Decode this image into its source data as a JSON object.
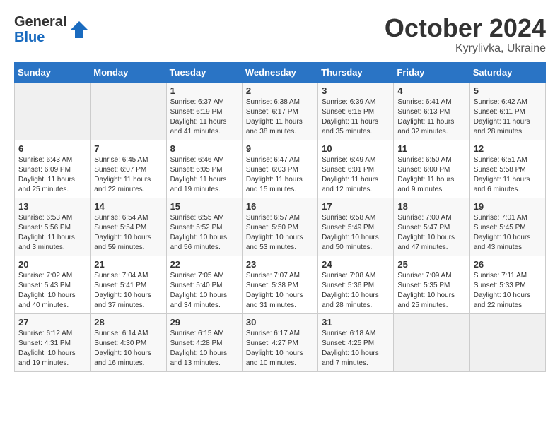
{
  "header": {
    "logo_general": "General",
    "logo_blue": "Blue",
    "month_title": "October 2024",
    "location": "Kyrylivka, Ukraine"
  },
  "days_of_week": [
    "Sunday",
    "Monday",
    "Tuesday",
    "Wednesday",
    "Thursday",
    "Friday",
    "Saturday"
  ],
  "weeks": [
    [
      {
        "day": "",
        "content": ""
      },
      {
        "day": "",
        "content": ""
      },
      {
        "day": "1",
        "content": "Sunrise: 6:37 AM\nSunset: 6:19 PM\nDaylight: 11 hours and 41 minutes."
      },
      {
        "day": "2",
        "content": "Sunrise: 6:38 AM\nSunset: 6:17 PM\nDaylight: 11 hours and 38 minutes."
      },
      {
        "day": "3",
        "content": "Sunrise: 6:39 AM\nSunset: 6:15 PM\nDaylight: 11 hours and 35 minutes."
      },
      {
        "day": "4",
        "content": "Sunrise: 6:41 AM\nSunset: 6:13 PM\nDaylight: 11 hours and 32 minutes."
      },
      {
        "day": "5",
        "content": "Sunrise: 6:42 AM\nSunset: 6:11 PM\nDaylight: 11 hours and 28 minutes."
      }
    ],
    [
      {
        "day": "6",
        "content": "Sunrise: 6:43 AM\nSunset: 6:09 PM\nDaylight: 11 hours and 25 minutes."
      },
      {
        "day": "7",
        "content": "Sunrise: 6:45 AM\nSunset: 6:07 PM\nDaylight: 11 hours and 22 minutes."
      },
      {
        "day": "8",
        "content": "Sunrise: 6:46 AM\nSunset: 6:05 PM\nDaylight: 11 hours and 19 minutes."
      },
      {
        "day": "9",
        "content": "Sunrise: 6:47 AM\nSunset: 6:03 PM\nDaylight: 11 hours and 15 minutes."
      },
      {
        "day": "10",
        "content": "Sunrise: 6:49 AM\nSunset: 6:01 PM\nDaylight: 11 hours and 12 minutes."
      },
      {
        "day": "11",
        "content": "Sunrise: 6:50 AM\nSunset: 6:00 PM\nDaylight: 11 hours and 9 minutes."
      },
      {
        "day": "12",
        "content": "Sunrise: 6:51 AM\nSunset: 5:58 PM\nDaylight: 11 hours and 6 minutes."
      }
    ],
    [
      {
        "day": "13",
        "content": "Sunrise: 6:53 AM\nSunset: 5:56 PM\nDaylight: 11 hours and 3 minutes."
      },
      {
        "day": "14",
        "content": "Sunrise: 6:54 AM\nSunset: 5:54 PM\nDaylight: 10 hours and 59 minutes."
      },
      {
        "day": "15",
        "content": "Sunrise: 6:55 AM\nSunset: 5:52 PM\nDaylight: 10 hours and 56 minutes."
      },
      {
        "day": "16",
        "content": "Sunrise: 6:57 AM\nSunset: 5:50 PM\nDaylight: 10 hours and 53 minutes."
      },
      {
        "day": "17",
        "content": "Sunrise: 6:58 AM\nSunset: 5:49 PM\nDaylight: 10 hours and 50 minutes."
      },
      {
        "day": "18",
        "content": "Sunrise: 7:00 AM\nSunset: 5:47 PM\nDaylight: 10 hours and 47 minutes."
      },
      {
        "day": "19",
        "content": "Sunrise: 7:01 AM\nSunset: 5:45 PM\nDaylight: 10 hours and 43 minutes."
      }
    ],
    [
      {
        "day": "20",
        "content": "Sunrise: 7:02 AM\nSunset: 5:43 PM\nDaylight: 10 hours and 40 minutes."
      },
      {
        "day": "21",
        "content": "Sunrise: 7:04 AM\nSunset: 5:41 PM\nDaylight: 10 hours and 37 minutes."
      },
      {
        "day": "22",
        "content": "Sunrise: 7:05 AM\nSunset: 5:40 PM\nDaylight: 10 hours and 34 minutes."
      },
      {
        "day": "23",
        "content": "Sunrise: 7:07 AM\nSunset: 5:38 PM\nDaylight: 10 hours and 31 minutes."
      },
      {
        "day": "24",
        "content": "Sunrise: 7:08 AM\nSunset: 5:36 PM\nDaylight: 10 hours and 28 minutes."
      },
      {
        "day": "25",
        "content": "Sunrise: 7:09 AM\nSunset: 5:35 PM\nDaylight: 10 hours and 25 minutes."
      },
      {
        "day": "26",
        "content": "Sunrise: 7:11 AM\nSunset: 5:33 PM\nDaylight: 10 hours and 22 minutes."
      }
    ],
    [
      {
        "day": "27",
        "content": "Sunrise: 6:12 AM\nSunset: 4:31 PM\nDaylight: 10 hours and 19 minutes."
      },
      {
        "day": "28",
        "content": "Sunrise: 6:14 AM\nSunset: 4:30 PM\nDaylight: 10 hours and 16 minutes."
      },
      {
        "day": "29",
        "content": "Sunrise: 6:15 AM\nSunset: 4:28 PM\nDaylight: 10 hours and 13 minutes."
      },
      {
        "day": "30",
        "content": "Sunrise: 6:17 AM\nSunset: 4:27 PM\nDaylight: 10 hours and 10 minutes."
      },
      {
        "day": "31",
        "content": "Sunrise: 6:18 AM\nSunset: 4:25 PM\nDaylight: 10 hours and 7 minutes."
      },
      {
        "day": "",
        "content": ""
      },
      {
        "day": "",
        "content": ""
      }
    ]
  ]
}
